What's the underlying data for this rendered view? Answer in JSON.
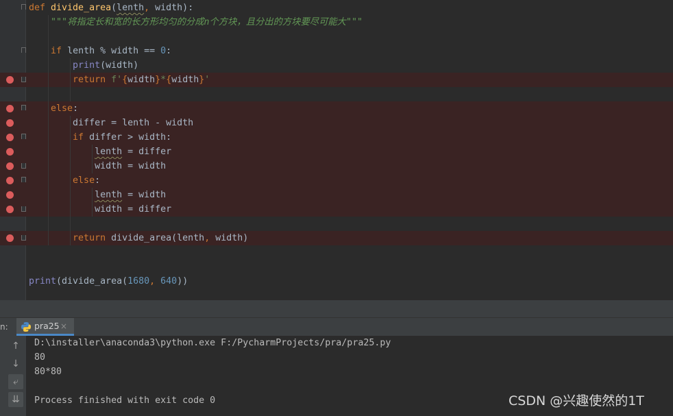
{
  "editor": {
    "lines": [
      [
        {
          "t": "def ",
          "c": "kw"
        },
        {
          "t": "divide_area",
          "c": "fn"
        },
        {
          "t": "("
        },
        {
          "t": "lenth",
          "c": "squig"
        },
        {
          "t": ", ",
          "c": "kw"
        },
        {
          "t": "width):"
        }
      ],
      [
        {
          "t": "    "
        },
        {
          "t": "\"\"\"将指定长和宽的长方形均匀的分成n个方块，且分出的方块要尽可能大\"\"\"",
          "c": "doc"
        }
      ],
      [],
      [
        {
          "t": "    "
        },
        {
          "t": "if ",
          "c": "kw"
        },
        {
          "t": "lenth % width == "
        },
        {
          "t": "0",
          "c": "num"
        },
        {
          "t": ":"
        }
      ],
      [
        {
          "t": "        "
        },
        {
          "t": "print",
          "c": "bi"
        },
        {
          "t": "(width)"
        }
      ],
      [
        {
          "t": "        "
        },
        {
          "t": "return ",
          "c": "kw"
        },
        {
          "t": "f'",
          "c": "str"
        },
        {
          "t": "{",
          "c": "brace"
        },
        {
          "t": "width"
        },
        {
          "t": "}",
          "c": "brace"
        },
        {
          "t": "*",
          "c": "str"
        },
        {
          "t": "{",
          "c": "brace"
        },
        {
          "t": "width"
        },
        {
          "t": "}",
          "c": "brace"
        },
        {
          "t": "'",
          "c": "str"
        }
      ],
      [],
      [
        {
          "t": "    "
        },
        {
          "t": "else",
          "c": "kw"
        },
        {
          "t": ":"
        }
      ],
      [
        {
          "t": "        "
        },
        {
          "t": "differ = lenth - width"
        }
      ],
      [
        {
          "t": "        "
        },
        {
          "t": "if ",
          "c": "kw"
        },
        {
          "t": "differ > width:"
        }
      ],
      [
        {
          "t": "            "
        },
        {
          "t": "lenth",
          "c": "squig"
        },
        {
          "t": " = differ"
        }
      ],
      [
        {
          "t": "            "
        },
        {
          "t": "width = width"
        }
      ],
      [
        {
          "t": "        "
        },
        {
          "t": "else",
          "c": "kw"
        },
        {
          "t": ":"
        }
      ],
      [
        {
          "t": "            "
        },
        {
          "t": "lenth",
          "c": "squig"
        },
        {
          "t": " = width"
        }
      ],
      [
        {
          "t": "            "
        },
        {
          "t": "width = differ"
        }
      ],
      [],
      [
        {
          "t": "        "
        },
        {
          "t": "return ",
          "c": "kw"
        },
        {
          "t": "divide_area(lenth"
        },
        {
          "t": ", ",
          "c": "kw"
        },
        {
          "t": "width)"
        }
      ],
      [],
      [],
      [
        {
          "t": "print",
          "c": "bi"
        },
        {
          "t": "(divide_area("
        },
        {
          "t": "1680",
          "c": "num"
        },
        {
          "t": ", ",
          "c": "kw"
        },
        {
          "t": "640",
          "c": "num"
        },
        {
          "t": "))"
        }
      ]
    ],
    "breakpoint_lines": [
      5,
      7,
      8,
      9,
      10,
      11,
      12,
      13,
      14,
      16
    ],
    "fold_lines": [
      0,
      3,
      5,
      7,
      9,
      11,
      12,
      14,
      16
    ]
  },
  "run_panel": {
    "label": "n:",
    "tab_label": "pra25",
    "tab_close": "×"
  },
  "console": {
    "lines": [
      "D:\\installer\\anaconda3\\python.exe F:/PycharmProjects/pra/pra25.py",
      "80",
      "80*80",
      "",
      "Process finished with exit code 0"
    ]
  },
  "toolbar": {
    "up_icon": "↑",
    "down_icon": "↓",
    "wrap_icon": "⤶",
    "scroll_end_icon": "⇊"
  },
  "watermark": "CSDN @兴趣使然的1T"
}
